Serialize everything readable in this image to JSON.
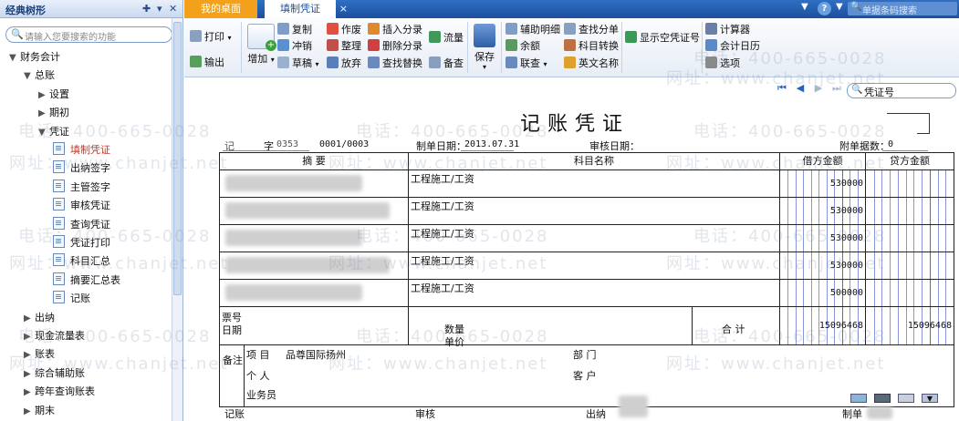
{
  "left_panel": {
    "title": "经典树形",
    "search_placeholder": "请输入您要搜索的功能",
    "tree": [
      {
        "label": "财务会计",
        "level": 0,
        "arrow": "▼",
        "type": "folder"
      },
      {
        "label": "总账",
        "level": 1,
        "arrow": "▼",
        "type": "folder"
      },
      {
        "label": "设置",
        "level": 2,
        "arrow": "▶",
        "type": "folder"
      },
      {
        "label": "期初",
        "level": 2,
        "arrow": "▶",
        "type": "folder"
      },
      {
        "label": "凭证",
        "level": 2,
        "arrow": "▼",
        "type": "folder"
      },
      {
        "label": "填制凭证",
        "level": 3,
        "arrow": "",
        "type": "doc",
        "selected": true
      },
      {
        "label": "出纳签字",
        "level": 3,
        "arrow": "",
        "type": "doc"
      },
      {
        "label": "主管签字",
        "level": 3,
        "arrow": "",
        "type": "doc"
      },
      {
        "label": "审核凭证",
        "level": 3,
        "arrow": "",
        "type": "doc"
      },
      {
        "label": "查询凭证",
        "level": 3,
        "arrow": "",
        "type": "doc"
      },
      {
        "label": "凭证打印",
        "level": 3,
        "arrow": "",
        "type": "doc"
      },
      {
        "label": "科目汇总",
        "level": 3,
        "arrow": "",
        "type": "doc"
      },
      {
        "label": "摘要汇总表",
        "level": 3,
        "arrow": "",
        "type": "doc"
      },
      {
        "label": "记账",
        "level": 3,
        "arrow": "",
        "type": "doc"
      },
      {
        "label": "出纳",
        "level": 1,
        "arrow": "▶",
        "type": "folder"
      },
      {
        "label": "现金流量表",
        "level": 1,
        "arrow": "▶",
        "type": "folder"
      },
      {
        "label": "账表",
        "level": 1,
        "arrow": "▶",
        "type": "folder"
      },
      {
        "label": "综合辅助账",
        "level": 1,
        "arrow": "▶",
        "type": "folder"
      },
      {
        "label": "跨年查询账表",
        "level": 1,
        "arrow": "▶",
        "type": "folder"
      },
      {
        "label": "期末",
        "level": 1,
        "arrow": "▶",
        "type": "folder"
      }
    ]
  },
  "tabs": {
    "desktop": "我的桌面",
    "active": "填制凭证",
    "close": "×",
    "barcode_placeholder": "单据条码搜索"
  },
  "toolbar": {
    "print": "打印",
    "export": "输出",
    "add": "增加",
    "copy": "复制",
    "reverse": "冲销",
    "draft": "草稿",
    "void": "作废",
    "organize": "整理",
    "discard": "放弃",
    "insert_entry": "插入分录",
    "delete_entry": "删除分录",
    "find_replace": "查找替换",
    "flow": "流量",
    "note": "备查",
    "save": "保存",
    "aux_detail": "辅助明细",
    "balance": "余额",
    "linked": "联查",
    "find_entry": "查找分单",
    "account_convert": "科目转换",
    "english_name": "英文名称",
    "show_empty": "显示空凭证号",
    "calculator": "计算器",
    "calendar": "会计日历",
    "options": "选项"
  },
  "nav": {
    "search_label": "凭证号"
  },
  "voucher": {
    "title": "记账凭证",
    "type": "记",
    "zi_label": "字",
    "zi_value": "0353",
    "number": "0001/0003",
    "date_label": "制单日期：",
    "date_value": "2013.07.31",
    "audit_label": "审核日期：",
    "attach_label": "附单据数：",
    "attach_value": "0",
    "headers": {
      "summary": "摘 要",
      "account": "科目名称",
      "debit": "借方金额",
      "credit": "贷方金额"
    },
    "rows": [
      {
        "account": "工程施工/工资",
        "debit": "530000",
        "credit": ""
      },
      {
        "account": "工程施工/工资",
        "debit": "530000",
        "credit": ""
      },
      {
        "account": "工程施工/工资",
        "debit": "530000",
        "credit": ""
      },
      {
        "account": "工程施工/工资",
        "debit": "530000",
        "credit": ""
      },
      {
        "account": "工程施工/工资",
        "debit": "500000",
        "credit": ""
      }
    ],
    "ticket_no": "票号",
    "ticket_date": "日期",
    "quantity": "数量",
    "unit_price": "单价",
    "total_label": "合 计",
    "total_debit": "15096468",
    "total_credit": "15096468",
    "remark": "备注",
    "project_label": "项 目",
    "project_value": "品尊国际扬州",
    "department_label": "部 门",
    "person_label": "个 人",
    "customer_label": "客 户",
    "salesman_label": "业务员",
    "footer": {
      "bookkeep": "记账",
      "audit": "审核",
      "cashier": "出纳",
      "maker": "制单"
    }
  },
  "watermark": {
    "phone": "电话：400-665-0028",
    "site": "网址：www.chanjet.net"
  },
  "colors": {
    "tab_bar": "#1d4f9c",
    "desk_tab": "#f3a11b",
    "selected_tree": "#c0392b",
    "grid_line": "#2a3fbf",
    "grid_red": "#d03030"
  }
}
